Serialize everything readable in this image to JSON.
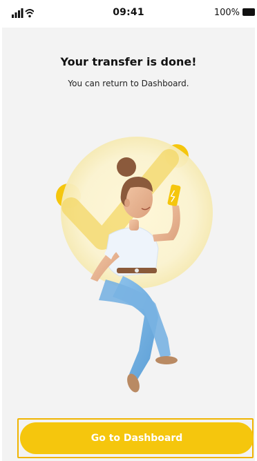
{
  "status_bar": {
    "time": "09:41",
    "battery_percent": "100%",
    "icons": [
      "signal-icon",
      "wifi-icon",
      "battery-icon"
    ]
  },
  "main": {
    "title": "Your transfer is done!",
    "subtitle": "You can return to Dashboard.",
    "illustration": "woman-with-phone-success-illustration"
  },
  "footer": {
    "primary_button_label": "Go to Dashboard"
  },
  "colors": {
    "accent": "#f5c60d",
    "background": "#f3f3f3"
  }
}
